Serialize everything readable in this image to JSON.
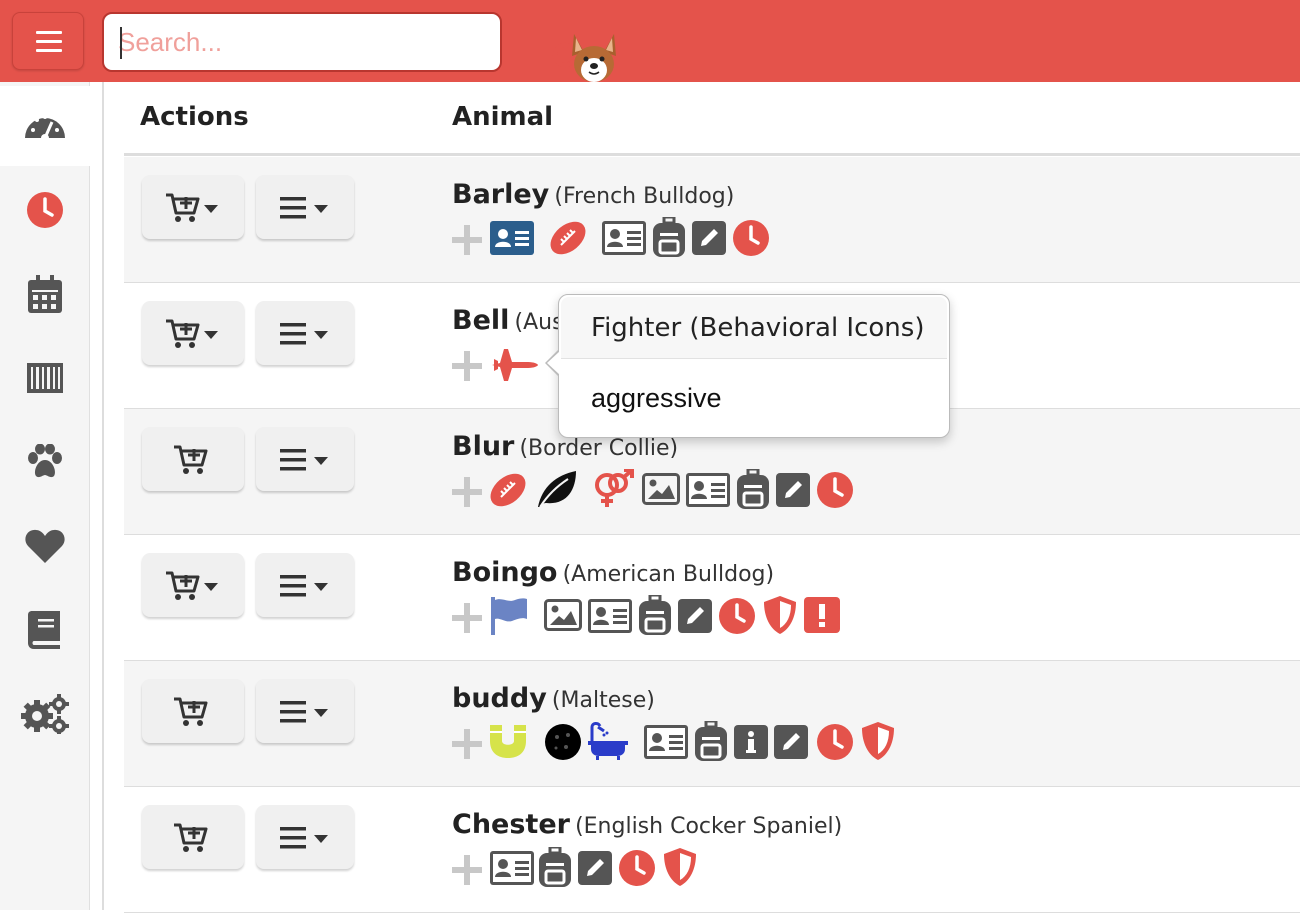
{
  "search": {
    "placeholder": "Search..."
  },
  "table": {
    "headers": {
      "actions": "Actions",
      "animal": "Animal"
    },
    "rows": [
      {
        "name": "Barley",
        "breed": "(French Bulldog)"
      },
      {
        "name": "Bell",
        "breed": "(Aus"
      },
      {
        "name": "Blur",
        "breed": "(Border Collie)"
      },
      {
        "name": "Boingo",
        "breed": "(American Bulldog)"
      },
      {
        "name": "buddy",
        "breed": "(Maltese)"
      },
      {
        "name": "Chester",
        "breed": "(English Cocker Spaniel)"
      }
    ]
  },
  "popover": {
    "title": "Fighter (Behavioral Icons)",
    "body": "aggressive"
  },
  "sidebar": {
    "items": [
      "dashboard-icon",
      "clock-icon",
      "calendar-icon",
      "barcode-icon",
      "paw-icon",
      "heart-icon",
      "book-icon",
      "settings-icon"
    ]
  },
  "colors": {
    "brand": "#e4534b",
    "icon_gray": "#555555",
    "id_card_blue": "#2b5e8c",
    "flag_blue": "#6b84c4",
    "magnet_lime": "#d6e34a",
    "bath_blue": "#2a3cc9"
  }
}
